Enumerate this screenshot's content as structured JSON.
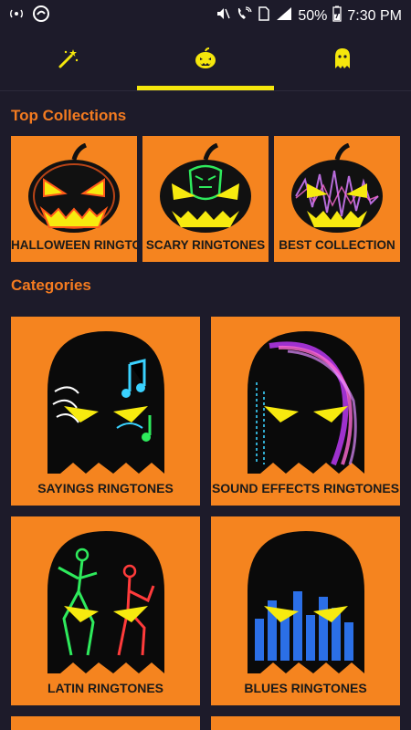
{
  "status_bar": {
    "battery": "50%",
    "time": "7:30 PM"
  },
  "tabs": [
    {
      "icon": "magic-wand-icon"
    },
    {
      "icon": "pumpkin-icon",
      "active": true
    },
    {
      "icon": "ghost-icon"
    }
  ],
  "top_collections": {
    "title": "Top Collections",
    "items": [
      {
        "label": "HALLOWEEN RINGTONES",
        "accent": "#ff5a1a"
      },
      {
        "label": "SCARY RINGTONES",
        "accent": "#2eea5c"
      },
      {
        "label": "BEST COLLECTION",
        "accent": "#d67cff"
      }
    ]
  },
  "categories": {
    "title": "Categories",
    "items": [
      {
        "label": "SAYINGS RINGTONES",
        "accent": "#3ad2ff"
      },
      {
        "label": "SOUND EFFECTS RINGTONES",
        "accent": "#c33bff"
      },
      {
        "label": "LATIN RINGTONES",
        "accent": "#ff3b3b"
      },
      {
        "label": "BLUES RINGTONES",
        "accent": "#2f7bff"
      }
    ]
  },
  "colors": {
    "background": "#1d1b2a",
    "card": "#f5841f",
    "section_title": "#f47b20",
    "tab_indicator": "#f5e70c",
    "eyes": "#f7ea0f"
  }
}
